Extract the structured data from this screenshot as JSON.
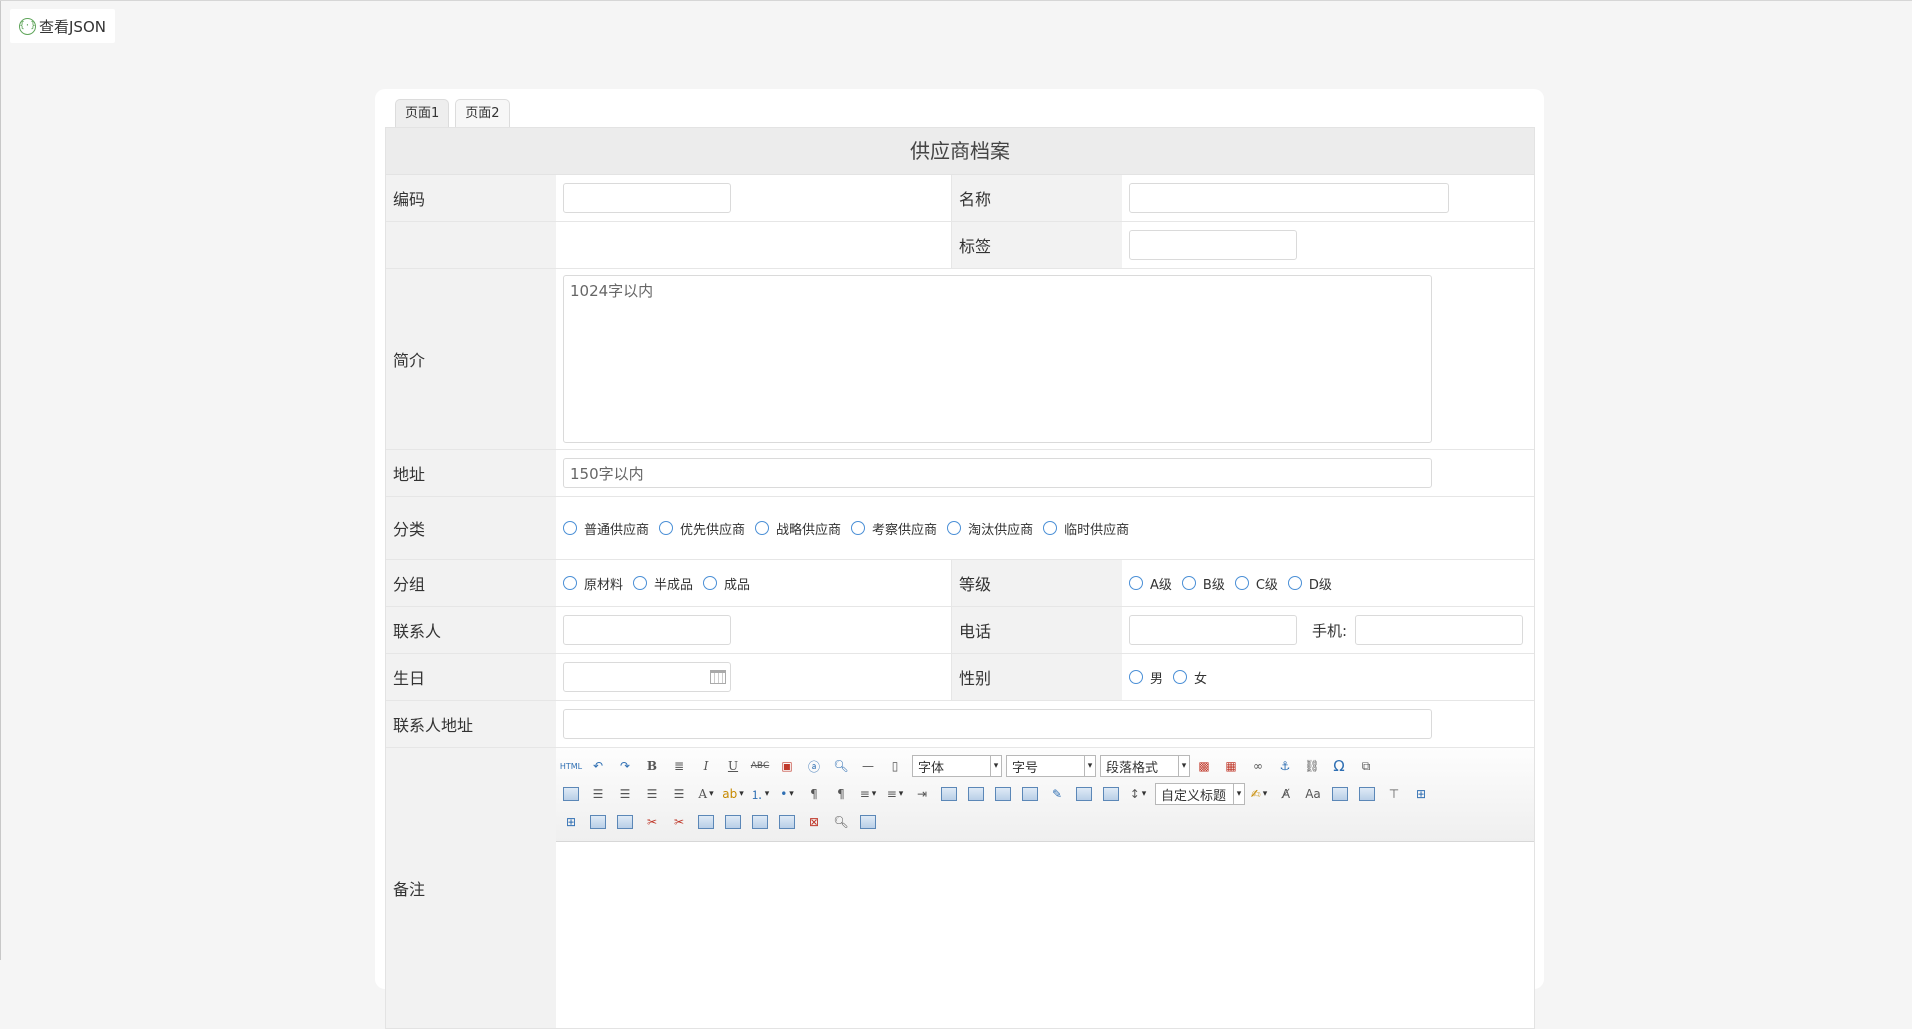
{
  "json_button": {
    "label": "查看JSON",
    "icon": "braces-icon",
    "icon_text": "{·}"
  },
  "tabs": [
    {
      "label": "页面1"
    },
    {
      "label": "页面2"
    }
  ],
  "form": {
    "title": "供应商档案",
    "code_label": "编码",
    "name_label": "名称",
    "tag_label": "标签",
    "intro_label": "简介",
    "intro_placeholder": "1024字以内",
    "address_label": "地址",
    "address_placeholder": "150字以内",
    "category_label": "分类",
    "category_options": [
      "普通供应商",
      "优先供应商",
      "战略供应商",
      "考察供应商",
      "淘汰供应商",
      "临时供应商"
    ],
    "group_label": "分组",
    "group_options": [
      "原材料",
      "半成品",
      "成品"
    ],
    "level_label": "等级",
    "level_options": [
      "A级",
      "B级",
      "C级",
      "D级"
    ],
    "contact_label": "联系人",
    "phone_label": "电话",
    "mobile_label": "手机:",
    "birthday_label": "生日",
    "gender_label": "性别",
    "gender_options": [
      "男",
      "女"
    ],
    "contact_address_label": "联系人地址",
    "remarks_label": "备注"
  },
  "editor": {
    "font_select": "字体",
    "size_select": "字号",
    "paragraph_select": "段落格式",
    "heading_select": "自定义标题",
    "toolbar_icons_row1": [
      "html-icon",
      "undo-icon",
      "redo-icon",
      "bold-icon",
      "format-icon",
      "italic-icon",
      "underline-icon",
      "strikethrough-icon",
      "paste-icon",
      "word-icon",
      "search-replace-icon",
      "horizontal-rule-icon",
      "blank-page-icon"
    ],
    "toolbar_icons_row1_end": [
      "image-icon",
      "multi-image-icon",
      "link-icon",
      "anchor-icon",
      "unlink-icon",
      "omega-icon",
      "binoculars-icon"
    ],
    "toolbar_icons_row2": [
      "print-icon",
      "align-left-icon",
      "align-center-icon",
      "align-right-icon",
      "justify-icon",
      "font-color-icon",
      "highlight-icon",
      "ordered-list-icon",
      "unordered-list-icon",
      "ltr-icon",
      "rtl-icon",
      "line-height-icon",
      "paragraph-spacing-icon",
      "indent-icon",
      "emotion-icon",
      "image-left-icon",
      "image-right-icon",
      "image-center-icon",
      "attachment-icon",
      "image-none-icon",
      "insert-image-icon",
      "row-spacing-icon"
    ],
    "toolbar_icons_row2_end": [
      "format-brush-icon",
      "clear-format-icon",
      "font-size-icon",
      "autotypeset-icon",
      "insert-table-icon",
      "insert-title-icon",
      "insert-row-icon"
    ],
    "toolbar_icons_row3": [
      "insert-col-icon",
      "merge-cells-icon",
      "merge-right-icon",
      "split-cells-icon",
      "delete-row-icon",
      "table-icon",
      "table-cols-icon",
      "table-grid-icon",
      "table-props-icon",
      "delete-table-icon",
      "preview-icon",
      "search-icon"
    ]
  }
}
